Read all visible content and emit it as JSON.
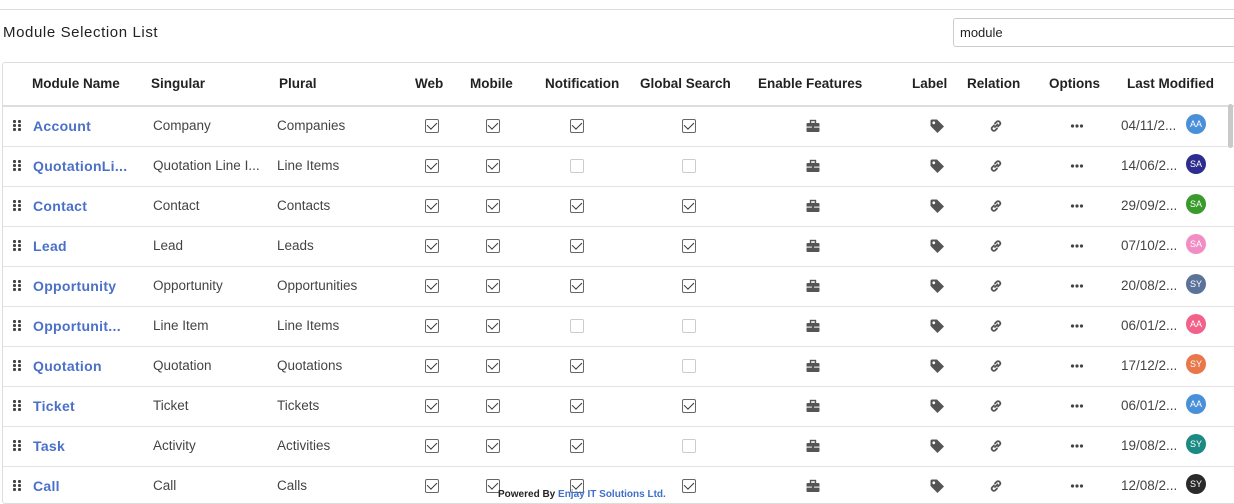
{
  "page": {
    "title": "Module Selection List",
    "search_value": "module",
    "footer_prefix": "Powered By",
    "footer_company": "Enjay IT Solutions Ltd."
  },
  "columns": {
    "module_name": "Module Name",
    "singular": "Singular",
    "plural": "Plural",
    "web": "Web",
    "mobile": "Mobile",
    "notification": "Notification",
    "global_search": "Global Search",
    "enable_features": "Enable Features",
    "label": "Label",
    "relation": "Relation",
    "options": "Options",
    "last_modified": "Last Modified"
  },
  "icons": {
    "drag": "drag-handle-icon",
    "enable_features": "toolbox-icon",
    "label": "tag-icon",
    "relation": "link-icon",
    "options": "ellipsis-icon"
  },
  "colors": {
    "link": "#4a70c9",
    "checkbox_border": "#666666"
  },
  "rows": [
    {
      "name": "Account",
      "singular": "Company",
      "plural": "Companies",
      "web": true,
      "mobile": true,
      "notification": true,
      "global_search": true,
      "date": "04/11/2...",
      "avatar": "AA",
      "avatar_color": "#4a90d9"
    },
    {
      "name": "QuotationLi...",
      "singular": "Quotation Line I...",
      "plural": "Line Items",
      "web": true,
      "mobile": true,
      "notification": false,
      "global_search": false,
      "date": "14/06/2...",
      "avatar": "SA",
      "avatar_color": "#2d2d8f"
    },
    {
      "name": "Contact",
      "singular": "Contact",
      "plural": "Contacts",
      "web": true,
      "mobile": true,
      "notification": true,
      "global_search": true,
      "date": "29/09/2...",
      "avatar": "SA",
      "avatar_color": "#3a9a2c"
    },
    {
      "name": "Lead",
      "singular": "Lead",
      "plural": "Leads",
      "web": true,
      "mobile": true,
      "notification": true,
      "global_search": true,
      "date": "07/10/2...",
      "avatar": "SA",
      "avatar_color": "#f28cc4"
    },
    {
      "name": "Opportunity",
      "singular": "Opportunity",
      "plural": "Opportunities",
      "web": true,
      "mobile": true,
      "notification": true,
      "global_search": true,
      "date": "20/08/2...",
      "avatar": "SY",
      "avatar_color": "#5b7399"
    },
    {
      "name": "Opportunit...",
      "singular": "Line Item",
      "plural": "Line Items",
      "web": true,
      "mobile": true,
      "notification": false,
      "global_search": false,
      "date": "06/01/2...",
      "avatar": "AA",
      "avatar_color": "#f2618a"
    },
    {
      "name": "Quotation",
      "singular": "Quotation",
      "plural": "Quotations",
      "web": true,
      "mobile": true,
      "notification": true,
      "global_search": false,
      "date": "17/12/2...",
      "avatar": "SY",
      "avatar_color": "#e8784a"
    },
    {
      "name": "Ticket",
      "singular": "Ticket",
      "plural": "Tickets",
      "web": true,
      "mobile": true,
      "notification": true,
      "global_search": true,
      "date": "06/01/2...",
      "avatar": "AA",
      "avatar_color": "#4a90d9"
    },
    {
      "name": "Task",
      "singular": "Activity",
      "plural": "Activities",
      "web": true,
      "mobile": true,
      "notification": true,
      "global_search": false,
      "date": "19/08/2...",
      "avatar": "SY",
      "avatar_color": "#1a8a82"
    },
    {
      "name": "Call",
      "singular": "Call",
      "plural": "Calls",
      "web": true,
      "mobile": true,
      "notification": true,
      "global_search": true,
      "date": "12/08/2...",
      "avatar": "SY",
      "avatar_color": "#2a2a2a"
    }
  ]
}
